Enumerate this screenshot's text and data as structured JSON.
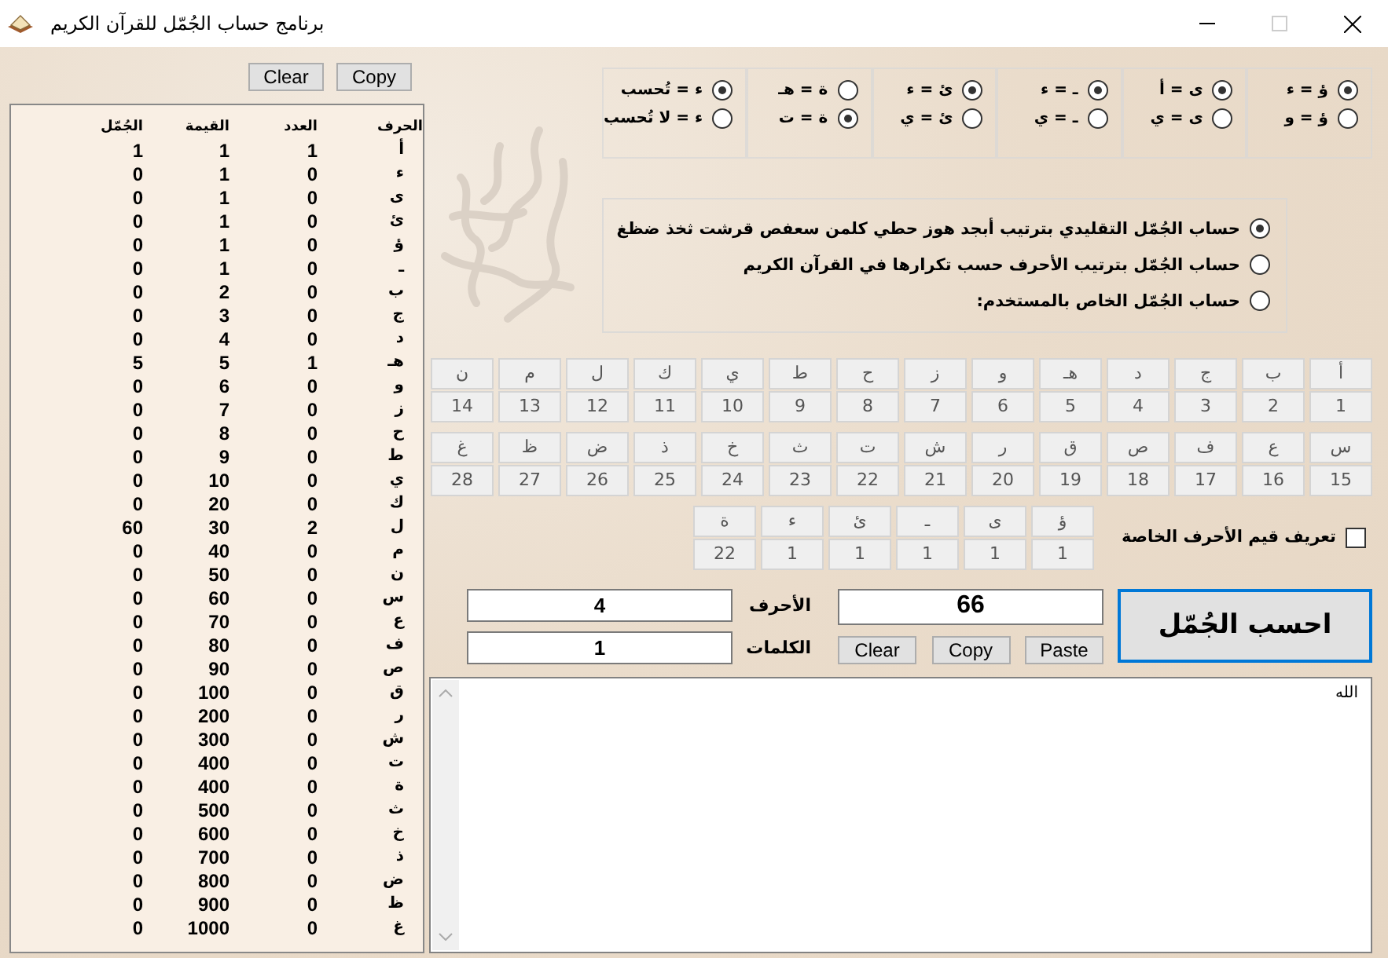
{
  "window": {
    "title": "برنامج حساب الجُمّل للقرآن الكريم"
  },
  "letter_table": {
    "buttons": [
      "Copy",
      "Clear"
    ],
    "columns": [
      "الحرف",
      "العدد",
      "القيمة",
      "الجُمّل"
    ],
    "rows": [
      [
        "أ",
        "1",
        "1",
        "1"
      ],
      [
        "ء",
        "0",
        "1",
        "0"
      ],
      [
        "ى",
        "0",
        "1",
        "0"
      ],
      [
        "ئ",
        "0",
        "1",
        "0"
      ],
      [
        "ؤ",
        "0",
        "1",
        "0"
      ],
      [
        "ـ",
        "0",
        "1",
        "0"
      ],
      [
        "ب",
        "0",
        "2",
        "0"
      ],
      [
        "ج",
        "0",
        "3",
        "0"
      ],
      [
        "د",
        "0",
        "4",
        "0"
      ],
      [
        "هـ",
        "1",
        "5",
        "5"
      ],
      [
        "و",
        "0",
        "6",
        "0"
      ],
      [
        "ز",
        "0",
        "7",
        "0"
      ],
      [
        "ح",
        "0",
        "8",
        "0"
      ],
      [
        "ط",
        "0",
        "9",
        "0"
      ],
      [
        "ي",
        "0",
        "10",
        "0"
      ],
      [
        "ك",
        "0",
        "20",
        "0"
      ],
      [
        "ل",
        "2",
        "30",
        "60"
      ],
      [
        "م",
        "0",
        "40",
        "0"
      ],
      [
        "ن",
        "0",
        "50",
        "0"
      ],
      [
        "س",
        "0",
        "60",
        "0"
      ],
      [
        "ع",
        "0",
        "70",
        "0"
      ],
      [
        "ف",
        "0",
        "80",
        "0"
      ],
      [
        "ص",
        "0",
        "90",
        "0"
      ],
      [
        "ق",
        "0",
        "100",
        "0"
      ],
      [
        "ر",
        "0",
        "200",
        "0"
      ],
      [
        "ش",
        "0",
        "300",
        "0"
      ],
      [
        "ت",
        "0",
        "400",
        "0"
      ],
      [
        "ة",
        "0",
        "400",
        "0"
      ],
      [
        "ث",
        "0",
        "500",
        "0"
      ],
      [
        "خ",
        "0",
        "600",
        "0"
      ],
      [
        "ذ",
        "0",
        "700",
        "0"
      ],
      [
        "ض",
        "0",
        "800",
        "0"
      ],
      [
        "ظ",
        "0",
        "900",
        "0"
      ],
      [
        "غ",
        "0",
        "1000",
        "0"
      ]
    ]
  },
  "radio_groups": [
    {
      "options": [
        {
          "label": "ؤ = ء",
          "selected": true
        },
        {
          "label": "ؤ = و",
          "selected": false
        }
      ]
    },
    {
      "options": [
        {
          "label": "ى = أ",
          "selected": true
        },
        {
          "label": "ى = ي",
          "selected": false
        }
      ]
    },
    {
      "options": [
        {
          "label": "ـ = ء",
          "selected": true
        },
        {
          "label": "ـ = ي",
          "selected": false
        }
      ]
    },
    {
      "options": [
        {
          "label": "ئ = ء",
          "selected": true
        },
        {
          "label": "ئ = ي",
          "selected": false
        }
      ]
    },
    {
      "options": [
        {
          "label": "ة = هـ",
          "selected": false
        },
        {
          "label": "ة = ت",
          "selected": true
        }
      ]
    },
    {
      "options": [
        {
          "label": "ء = تُحسب",
          "selected": true
        },
        {
          "label": "ء = لا تُحسب",
          "selected": false
        }
      ]
    }
  ],
  "methods": [
    {
      "label": "حساب الجُمّل التقليدي بترتيب أبجد هوز حطي كلمن سعفص قرشت ثخذ ضظغ",
      "selected": true
    },
    {
      "label": "حساب الجُمّل بترتيب الأحرف حسب تكرارها في القرآن الكريم",
      "selected": false
    },
    {
      "label": "حساب  الجُمّل الخاص بالمستخدم:",
      "selected": false
    }
  ],
  "letter_grid": [
    [
      {
        "letter": "أ",
        "value": "1"
      },
      {
        "letter": "ب",
        "value": "2"
      },
      {
        "letter": "ج",
        "value": "3"
      },
      {
        "letter": "د",
        "value": "4"
      },
      {
        "letter": "هـ",
        "value": "5"
      },
      {
        "letter": "و",
        "value": "6"
      },
      {
        "letter": "ز",
        "value": "7"
      },
      {
        "letter": "ح",
        "value": "8"
      },
      {
        "letter": "ط",
        "value": "9"
      },
      {
        "letter": "ي",
        "value": "10"
      },
      {
        "letter": "ك",
        "value": "11"
      },
      {
        "letter": "ل",
        "value": "12"
      },
      {
        "letter": "م",
        "value": "13"
      },
      {
        "letter": "ن",
        "value": "14"
      }
    ],
    [
      {
        "letter": "س",
        "value": "15"
      },
      {
        "letter": "ع",
        "value": "16"
      },
      {
        "letter": "ف",
        "value": "17"
      },
      {
        "letter": "ص",
        "value": "18"
      },
      {
        "letter": "ق",
        "value": "19"
      },
      {
        "letter": "ر",
        "value": "20"
      },
      {
        "letter": "ش",
        "value": "21"
      },
      {
        "letter": "ت",
        "value": "22"
      },
      {
        "letter": "ث",
        "value": "23"
      },
      {
        "letter": "خ",
        "value": "24"
      },
      {
        "letter": "ذ",
        "value": "25"
      },
      {
        "letter": "ض",
        "value": "26"
      },
      {
        "letter": "ظ",
        "value": "27"
      },
      {
        "letter": "غ",
        "value": "28"
      }
    ]
  ],
  "special_letters": {
    "checkbox": {
      "label": "تعريف قيم الأحرف الخاصة",
      "checked": false
    },
    "cells": [
      {
        "letter": "ؤ",
        "value": "1"
      },
      {
        "letter": "ى",
        "value": "1"
      },
      {
        "letter": "ـ",
        "value": "1"
      },
      {
        "letter": "ئ",
        "value": "1"
      },
      {
        "letter": "ء",
        "value": "1"
      },
      {
        "letter": "ة",
        "value": "22"
      }
    ]
  },
  "calculate_button": "احسب الجُمّل",
  "result": {
    "value": "66",
    "buttons": [
      "Paste",
      "Copy",
      "Clear"
    ]
  },
  "counts": [
    {
      "label": "الأحرف",
      "value": "4"
    },
    {
      "label": "الكلمات",
      "value": "1"
    }
  ],
  "input_text": "الله"
}
